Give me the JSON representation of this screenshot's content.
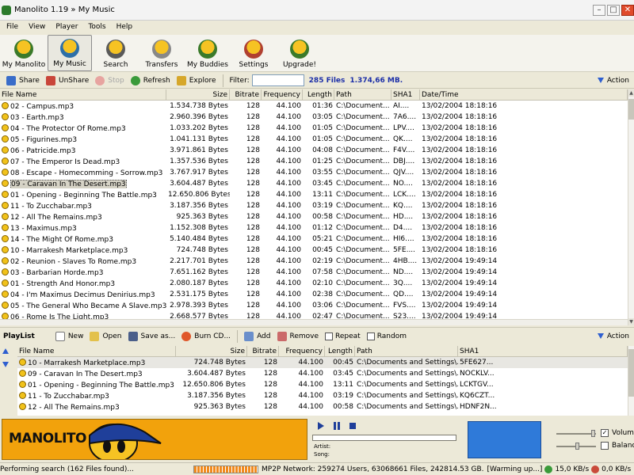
{
  "window": {
    "title": "Manolito 1.19 » My Music"
  },
  "menu": [
    "File",
    "View",
    "Player",
    "Tools",
    "Help"
  ],
  "toolbar": [
    {
      "label": "My Manolito",
      "icon": "bug-icon"
    },
    {
      "label": "My Music",
      "icon": "music-bug-icon"
    },
    {
      "label": "Search",
      "icon": "search-bug-icon"
    },
    {
      "label": "Transfers",
      "icon": "transfers-icon"
    },
    {
      "label": "My Buddies",
      "icon": "buddies-icon"
    },
    {
      "label": "Settings",
      "icon": "settings-icon"
    },
    {
      "label": "Upgrade!",
      "icon": "upgrade-icon"
    }
  ],
  "subtoolbar": {
    "share": "Share",
    "unshare": "UnShare",
    "stop": "Stop",
    "refresh": "Refresh",
    "explore": "Explore",
    "filter_label": "Filter:",
    "filter_value": "",
    "files_count": "285 Files",
    "files_size": "1.374,66 MB.",
    "action": "Action"
  },
  "file_columns": [
    "File Name",
    "Size",
    "Bitrate",
    "Frequency",
    "Length",
    "Path",
    "SHA1",
    "Date/Time"
  ],
  "files": [
    {
      "name": "02 - Campus.mp3",
      "size": "1.534.738 Bytes",
      "bitrate": "128",
      "freq": "44.100",
      "len": "01:36",
      "path": "C:\\Document...",
      "sha": "AI....",
      "date": "13/02/2004 18:18:16"
    },
    {
      "name": "03 - Earth.mp3",
      "size": "2.960.396 Bytes",
      "bitrate": "128",
      "freq": "44.100",
      "len": "03:05",
      "path": "C:\\Document...",
      "sha": "7A6....",
      "date": "13/02/2004 18:18:16"
    },
    {
      "name": "04 - The Protector Of Rome.mp3",
      "size": "1.033.202 Bytes",
      "bitrate": "128",
      "freq": "44.100",
      "len": "01:05",
      "path": "C:\\Document...",
      "sha": "LPV....",
      "date": "13/02/2004 18:18:16"
    },
    {
      "name": "05 - Figurines.mp3",
      "size": "1.041.131 Bytes",
      "bitrate": "128",
      "freq": "44.100",
      "len": "01:05",
      "path": "C:\\Document...",
      "sha": "QK....",
      "date": "13/02/2004 18:18:16"
    },
    {
      "name": "06 - Patricide.mp3",
      "size": "3.971.861 Bytes",
      "bitrate": "128",
      "freq": "44.100",
      "len": "04:08",
      "path": "C:\\Document...",
      "sha": "F4V....",
      "date": "13/02/2004 18:18:16"
    },
    {
      "name": "07 - The Emperor Is Dead.mp3",
      "size": "1.357.536 Bytes",
      "bitrate": "128",
      "freq": "44.100",
      "len": "01:25",
      "path": "C:\\Document...",
      "sha": "DBJ....",
      "date": "13/02/2004 18:18:16"
    },
    {
      "name": "08 - Escape - Homecomming - Sorrow.mp3",
      "size": "3.767.917 Bytes",
      "bitrate": "128",
      "freq": "44.100",
      "len": "03:55",
      "path": "C:\\Document...",
      "sha": "QJV....",
      "date": "13/02/2004 18:18:16"
    },
    {
      "name": "09 - Caravan In The Desert.mp3",
      "size": "3.604.487 Bytes",
      "bitrate": "128",
      "freq": "44.100",
      "len": "03:45",
      "path": "C:\\Document...",
      "sha": "NO....",
      "date": "13/02/2004 18:18:16",
      "selected": true
    },
    {
      "name": "01 - Opening - Beginning The Battle.mp3",
      "size": "12.650.806 Bytes",
      "bitrate": "128",
      "freq": "44.100",
      "len": "13:11",
      "path": "C:\\Document...",
      "sha": "LCK....",
      "date": "13/02/2004 18:18:16"
    },
    {
      "name": "11 - To Zucchabar.mp3",
      "size": "3.187.356 Bytes",
      "bitrate": "128",
      "freq": "44.100",
      "len": "03:19",
      "path": "C:\\Document...",
      "sha": "KQ....",
      "date": "13/02/2004 18:18:16"
    },
    {
      "name": "12 - All The Remains.mp3",
      "size": "925.363 Bytes",
      "bitrate": "128",
      "freq": "44.100",
      "len": "00:58",
      "path": "C:\\Document...",
      "sha": "HD....",
      "date": "13/02/2004 18:18:16"
    },
    {
      "name": "13 - Maximus.mp3",
      "size": "1.152.308 Bytes",
      "bitrate": "128",
      "freq": "44.100",
      "len": "01:12",
      "path": "C:\\Document...",
      "sha": "D4....",
      "date": "13/02/2004 18:18:16"
    },
    {
      "name": "14 - The Might Of Rome.mp3",
      "size": "5.140.484 Bytes",
      "bitrate": "128",
      "freq": "44.100",
      "len": "05:21",
      "path": "C:\\Document...",
      "sha": "HI6....",
      "date": "13/02/2004 18:18:16"
    },
    {
      "name": "10 - Marrakesh Marketplace.mp3",
      "size": "724.748 Bytes",
      "bitrate": "128",
      "freq": "44.100",
      "len": "00:45",
      "path": "C:\\Document...",
      "sha": "5FE....",
      "date": "13/02/2004 18:18:16"
    },
    {
      "name": "02 - Reunion - Slaves To Rome.mp3",
      "size": "2.217.701 Bytes",
      "bitrate": "128",
      "freq": "44.100",
      "len": "02:19",
      "path": "C:\\Document...",
      "sha": "4HB....",
      "date": "13/02/2004 19:49:14"
    },
    {
      "name": "03 - Barbarian Horde.mp3",
      "size": "7.651.162 Bytes",
      "bitrate": "128",
      "freq": "44.100",
      "len": "07:58",
      "path": "C:\\Document...",
      "sha": "ND....",
      "date": "13/02/2004 19:49:14"
    },
    {
      "name": "01 - Strength And Honor.mp3",
      "size": "2.080.187 Bytes",
      "bitrate": "128",
      "freq": "44.100",
      "len": "02:10",
      "path": "C:\\Document...",
      "sha": "3Q....",
      "date": "13/02/2004 19:49:14"
    },
    {
      "name": "04 - I'm Maximus Decimus Denirius.mp3",
      "size": "2.531.175 Bytes",
      "bitrate": "128",
      "freq": "44.100",
      "len": "02:38",
      "path": "C:\\Document...",
      "sha": "QD....",
      "date": "13/02/2004 19:49:14"
    },
    {
      "name": "05 - The General Who Became A Slave.mp3",
      "size": "2.978.393 Bytes",
      "bitrate": "128",
      "freq": "44.100",
      "len": "03:06",
      "path": "C:\\Document...",
      "sha": "FVS....",
      "date": "13/02/2004 19:49:14"
    },
    {
      "name": "06 - Rome Is The Light.mp3",
      "size": "2.668.577 Bytes",
      "bitrate": "128",
      "freq": "44.100",
      "len": "02:47",
      "path": "C:\\Document...",
      "sha": "S23....",
      "date": "13/02/2004 19:49:14"
    }
  ],
  "playlist_toolbar": {
    "title": "PlayList",
    "new": "New",
    "open": "Open",
    "save_as": "Save as...",
    "burn": "Burn CD...",
    "add": "Add",
    "remove": "Remove",
    "repeat": "Repeat",
    "random": "Random",
    "action": "Action"
  },
  "playlist_columns": [
    "File Name",
    "Size",
    "Bitrate",
    "Frequency",
    "Length",
    "Path",
    "SHA1"
  ],
  "playlist": [
    {
      "name": "10 - Marrakesh Marketplace.mp3",
      "size": "724.748 Bytes",
      "bitrate": "128",
      "freq": "44.100",
      "len": "00:45",
      "path": "C:\\Documents and Settings\\...",
      "sha": "5FE627..."
    },
    {
      "name": "09 - Caravan In The Desert.mp3",
      "size": "3.604.487 Bytes",
      "bitrate": "128",
      "freq": "44.100",
      "len": "03:45",
      "path": "C:\\Documents and Settings\\...",
      "sha": "NOCKLV..."
    },
    {
      "name": "01 - Opening - Beginning The Battle.mp3",
      "size": "12.650.806 Bytes",
      "bitrate": "128",
      "freq": "44.100",
      "len": "13:11",
      "path": "C:\\Documents and Settings\\...",
      "sha": "LCKTGV..."
    },
    {
      "name": "11 - To Zucchabar.mp3",
      "size": "3.187.356 Bytes",
      "bitrate": "128",
      "freq": "44.100",
      "len": "03:19",
      "path": "C:\\Documents and Settings\\...",
      "sha": "KQ6CZT..."
    },
    {
      "name": "12 - All The Remains.mp3",
      "size": "925.363 Bytes",
      "bitrate": "128",
      "freq": "44.100",
      "len": "00:58",
      "path": "C:\\Documents and Settings\\...",
      "sha": "HDNF2N..."
    }
  ],
  "player": {
    "artist_label": "Artist:",
    "song_label": "Song:",
    "artist": "",
    "song": ""
  },
  "logo_text": "MANOLITO",
  "volume": {
    "label": "Volume",
    "balance": "Balance",
    "volume_checked": true,
    "balance_checked": false
  },
  "status": {
    "left": "Performing search (162 Files found)...",
    "network": "MP2P Network: 259274 Users, 63068661 Files, 242814.53 GB.",
    "warming": "[Warming up...]",
    "down_rate": "15,0  KB/s",
    "up_rate": "0,0  KB/s"
  },
  "colors": {
    "accent": "#2e5fd0",
    "logo_bg": "#f2a20c",
    "viz": "#2f7ad9",
    "count_text": "#1c2fa8"
  }
}
